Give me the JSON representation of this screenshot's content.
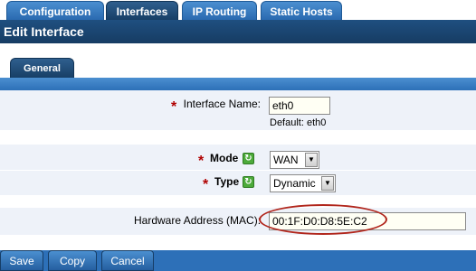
{
  "top_tabs": [
    {
      "label": "Configuration"
    },
    {
      "label": "Interfaces"
    },
    {
      "label": "IP Routing"
    },
    {
      "label": "Static Hosts"
    }
  ],
  "title": "Edit Interface",
  "sub_tab": "General",
  "form": {
    "interface_name": {
      "required_mark": "*",
      "label": "Interface Name:",
      "value": "eth0",
      "hint": "Default: eth0"
    },
    "mode": {
      "required_mark": "*",
      "label": "Mode",
      "value": "WAN"
    },
    "type": {
      "required_mark": "*",
      "label": "Type",
      "value": "Dynamic"
    },
    "hardware_address": {
      "label": "Hardware Address (MAC):",
      "value": "00:1F:D0:D8:5E:C2"
    }
  },
  "buttons": {
    "save": "Save",
    "copy": "Copy",
    "cancel": "Cancel"
  },
  "icons": {
    "refresh_icon": "refresh-icon",
    "dropdown_icon": "chevron-down-icon"
  }
}
